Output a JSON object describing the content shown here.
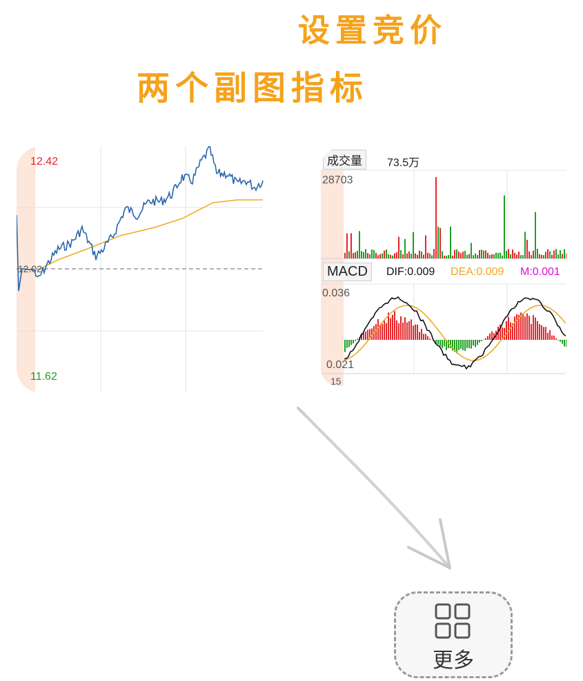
{
  "headings": {
    "title": "设置竞价",
    "subtitle": "两个副图指标"
  },
  "price_chart": {
    "high_label": "12.42",
    "mid_label": "12.02",
    "low_label": "11.62",
    "colors": {
      "price": "#2a64ad",
      "avg": "#f0a81f",
      "up": "#e5242a",
      "down": "#1e9e21",
      "highlight": "#fde6da"
    }
  },
  "volume_panel": {
    "tag_label": "成交量",
    "tag_value": "73.5万",
    "max_label": "28703"
  },
  "macd_panel": {
    "tag_label": "MACD",
    "dif": "DIF:0.009",
    "dea": "DEA:0.009",
    "m": "M:0.001",
    "max_label": "0.036",
    "min_label": "0.021",
    "bottom_label": "15",
    "colors": {
      "dif": "#111111",
      "dea": "#f0a81f",
      "m": "#d80fd8"
    }
  },
  "more_button": {
    "label": "更多",
    "icon": "grid-icon"
  }
}
